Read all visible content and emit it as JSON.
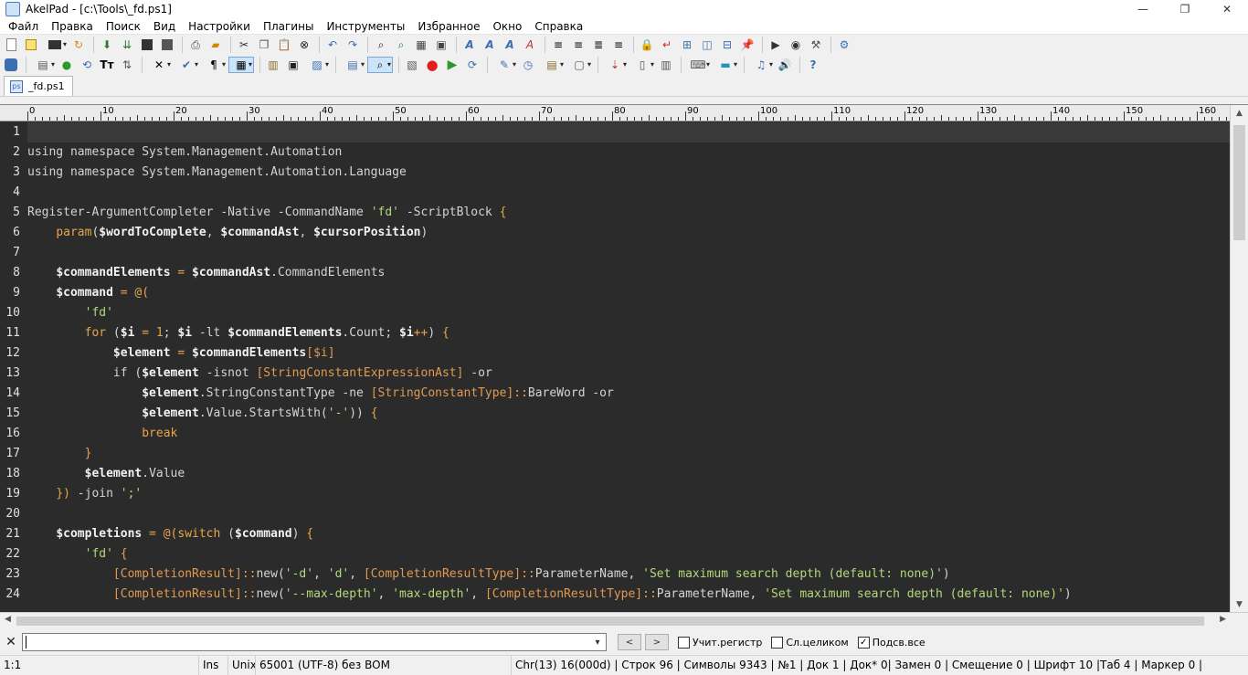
{
  "window": {
    "title": "AkelPad - [c:\\Tools\\_fd.ps1]",
    "controls": [
      "—",
      "❐",
      "✕"
    ]
  },
  "menu": [
    "Файл",
    "Правка",
    "Поиск",
    "Вид",
    "Настройки",
    "Плагины",
    "Инструменты",
    "Избранное",
    "Окно",
    "Справка"
  ],
  "tabs": [
    {
      "label": "_fd.ps1",
      "active": true
    }
  ],
  "ruler": {
    "labels": [
      "0",
      "10",
      "20",
      "30",
      "40",
      "50",
      "60",
      "70",
      "80",
      "90",
      "100",
      "110",
      "120",
      "130",
      "140",
      "150",
      "160"
    ]
  },
  "editor": {
    "lines": [
      {
        "n": "1",
        "tokens": [],
        "current": true
      },
      {
        "n": "2",
        "tokens": [
          {
            "t": "using namespace System.Management.Automation",
            "c": ""
          }
        ]
      },
      {
        "n": "3",
        "tokens": [
          {
            "t": "using namespace System.Management.Automation.Language",
            "c": ""
          }
        ]
      },
      {
        "n": "4",
        "tokens": []
      },
      {
        "n": "5",
        "tokens": [
          {
            "t": "Register-ArgumentCompleter -Native -CommandName ",
            "c": ""
          },
          {
            "t": "'fd'",
            "c": "str"
          },
          {
            "t": " -ScriptBlock ",
            "c": ""
          },
          {
            "t": "{",
            "c": "kw"
          }
        ]
      },
      {
        "n": "6",
        "tokens": [
          {
            "t": "    ",
            "c": ""
          },
          {
            "t": "param",
            "c": "kw"
          },
          {
            "t": "(",
            "c": ""
          },
          {
            "t": "$wordToComplete",
            "c": "var"
          },
          {
            "t": ", ",
            "c": ""
          },
          {
            "t": "$commandAst",
            "c": "var"
          },
          {
            "t": ", ",
            "c": ""
          },
          {
            "t": "$cursorPosition",
            "c": "var"
          },
          {
            "t": ")",
            "c": ""
          }
        ]
      },
      {
        "n": "7",
        "tokens": []
      },
      {
        "n": "8",
        "tokens": [
          {
            "t": "    ",
            "c": ""
          },
          {
            "t": "$commandElements",
            "c": "var"
          },
          {
            "t": " = ",
            "c": "kw"
          },
          {
            "t": "$commandAst",
            "c": "var"
          },
          {
            "t": ".CommandElements",
            "c": ""
          }
        ]
      },
      {
        "n": "9",
        "tokens": [
          {
            "t": "    ",
            "c": ""
          },
          {
            "t": "$command",
            "c": "var"
          },
          {
            "t": " = @(",
            "c": "kw"
          }
        ]
      },
      {
        "n": "10",
        "tokens": [
          {
            "t": "        ",
            "c": ""
          },
          {
            "t": "'fd'",
            "c": "str"
          }
        ]
      },
      {
        "n": "11",
        "tokens": [
          {
            "t": "        ",
            "c": ""
          },
          {
            "t": "for",
            "c": "kw"
          },
          {
            "t": " (",
            "c": ""
          },
          {
            "t": "$i",
            "c": "var"
          },
          {
            "t": " = ",
            "c": "kw"
          },
          {
            "t": "1",
            "c": "num"
          },
          {
            "t": "; ",
            "c": ""
          },
          {
            "t": "$i",
            "c": "var"
          },
          {
            "t": " -lt ",
            "c": ""
          },
          {
            "t": "$commandElements",
            "c": "var"
          },
          {
            "t": ".Count; ",
            "c": ""
          },
          {
            "t": "$i",
            "c": "var"
          },
          {
            "t": "++",
            "c": "kw"
          },
          {
            "t": ") ",
            "c": ""
          },
          {
            "t": "{",
            "c": "kw"
          }
        ]
      },
      {
        "n": "12",
        "tokens": [
          {
            "t": "            ",
            "c": ""
          },
          {
            "t": "$element",
            "c": "var"
          },
          {
            "t": " = ",
            "c": "kw"
          },
          {
            "t": "$commandElements",
            "c": "var"
          },
          {
            "t": "[$i]",
            "c": "type"
          }
        ]
      },
      {
        "n": "13",
        "tokens": [
          {
            "t": "            if (",
            "c": ""
          },
          {
            "t": "$element",
            "c": "var"
          },
          {
            "t": " -isnot ",
            "c": ""
          },
          {
            "t": "[StringConstantExpressionAst]",
            "c": "type"
          },
          {
            "t": " -or",
            "c": ""
          }
        ]
      },
      {
        "n": "14",
        "tokens": [
          {
            "t": "                ",
            "c": ""
          },
          {
            "t": "$element",
            "c": "var"
          },
          {
            "t": ".StringConstantType -ne ",
            "c": ""
          },
          {
            "t": "[StringConstantType]",
            "c": "type"
          },
          {
            "t": "::",
            "c": "kw"
          },
          {
            "t": "BareWord -or",
            "c": ""
          }
        ]
      },
      {
        "n": "15",
        "tokens": [
          {
            "t": "                ",
            "c": ""
          },
          {
            "t": "$element",
            "c": "var"
          },
          {
            "t": ".Value.StartsWith(",
            "c": ""
          },
          {
            "t": "'-'",
            "c": "str"
          },
          {
            "t": ")) ",
            "c": ""
          },
          {
            "t": "{",
            "c": "kw"
          }
        ]
      },
      {
        "n": "16",
        "tokens": [
          {
            "t": "                ",
            "c": ""
          },
          {
            "t": "break",
            "c": "kw"
          }
        ]
      },
      {
        "n": "17",
        "tokens": [
          {
            "t": "        ",
            "c": ""
          },
          {
            "t": "}",
            "c": "kw"
          }
        ]
      },
      {
        "n": "18",
        "tokens": [
          {
            "t": "        ",
            "c": ""
          },
          {
            "t": "$element",
            "c": "var"
          },
          {
            "t": ".Value",
            "c": ""
          }
        ]
      },
      {
        "n": "19",
        "tokens": [
          {
            "t": "    ",
            "c": ""
          },
          {
            "t": "})",
            "c": "kw"
          },
          {
            "t": " -join ",
            "c": ""
          },
          {
            "t": "';'",
            "c": "str"
          }
        ]
      },
      {
        "n": "20",
        "tokens": []
      },
      {
        "n": "21",
        "tokens": [
          {
            "t": "    ",
            "c": ""
          },
          {
            "t": "$completions",
            "c": "var"
          },
          {
            "t": " = @(",
            "c": "kw"
          },
          {
            "t": "switch",
            "c": "kw"
          },
          {
            "t": " (",
            "c": ""
          },
          {
            "t": "$command",
            "c": "var"
          },
          {
            "t": ") ",
            "c": ""
          },
          {
            "t": "{",
            "c": "kw"
          }
        ]
      },
      {
        "n": "22",
        "tokens": [
          {
            "t": "        ",
            "c": ""
          },
          {
            "t": "'fd'",
            "c": "str"
          },
          {
            "t": " ",
            "c": ""
          },
          {
            "t": "{",
            "c": "kw"
          }
        ]
      },
      {
        "n": "23",
        "tokens": [
          {
            "t": "            ",
            "c": ""
          },
          {
            "t": "[CompletionResult]",
            "c": "type"
          },
          {
            "t": "::",
            "c": "kw"
          },
          {
            "t": "new(",
            "c": ""
          },
          {
            "t": "'-d'",
            "c": "str"
          },
          {
            "t": ", ",
            "c": ""
          },
          {
            "t": "'d'",
            "c": "str"
          },
          {
            "t": ", ",
            "c": ""
          },
          {
            "t": "[CompletionResultType]",
            "c": "type"
          },
          {
            "t": "::",
            "c": "kw"
          },
          {
            "t": "ParameterName, ",
            "c": ""
          },
          {
            "t": "'Set maximum search depth (default: none)'",
            "c": "str"
          },
          {
            "t": ")",
            "c": ""
          }
        ]
      },
      {
        "n": "24",
        "tokens": [
          {
            "t": "            ",
            "c": ""
          },
          {
            "t": "[CompletionResult]",
            "c": "type"
          },
          {
            "t": "::",
            "c": "kw"
          },
          {
            "t": "new(",
            "c": ""
          },
          {
            "t": "'--max-depth'",
            "c": "str"
          },
          {
            "t": ", ",
            "c": ""
          },
          {
            "t": "'max-depth'",
            "c": "str"
          },
          {
            "t": ", ",
            "c": ""
          },
          {
            "t": "[CompletionResultType]",
            "c": "type"
          },
          {
            "t": "::",
            "c": "kw"
          },
          {
            "t": "ParameterName, ",
            "c": ""
          },
          {
            "t": "'Set maximum search depth (default: none)'",
            "c": "str"
          },
          {
            "t": ")",
            "c": ""
          }
        ]
      }
    ]
  },
  "findbar": {
    "value": "",
    "prev": "<",
    "next": ">",
    "match_case": {
      "label": "Учит.регистр",
      "checked": false
    },
    "whole_word": {
      "label": "Сл.целиком",
      "checked": false
    },
    "highlight_all": {
      "label": "Подсв.все",
      "checked": true
    }
  },
  "status": {
    "position": "1:1",
    "ins": "Ins",
    "newline": "Unix",
    "encoding": "65001 (UTF-8) без BOM",
    "details": "Chr(13) 16(000d) | Строк 96 | Символы 9343 | №1 | Док 1 | Док* 0| Замен 0 | Смещение 0 | Шрифт 10 |Таб 4 | Маркер 0 |"
  }
}
